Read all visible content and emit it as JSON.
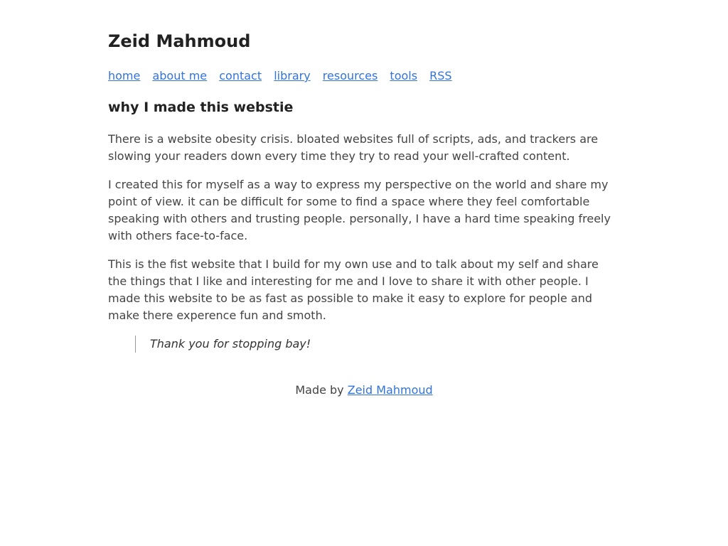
{
  "header": {
    "site_title": "Zeid Mahmoud"
  },
  "nav": {
    "items": [
      {
        "label": "home"
      },
      {
        "label": "about me"
      },
      {
        "label": "contact"
      },
      {
        "label": "library"
      },
      {
        "label": "resources"
      },
      {
        "label": "tools"
      },
      {
        "label": "RSS"
      }
    ]
  },
  "main": {
    "title": "why I made this webstie",
    "paragraphs": [
      "There is a website obesity crisis. bloated websites full of scripts, ads, and trackers are slowing your readers down every time they try to read your well-crafted content.",
      "I created this for myself as a way to express my perspective on the world and share my point of view. it can be difficult for some to find a space where they feel comfortable speaking with others and trusting people. personally, I have a hard time speaking freely with others face-to-face.",
      "This is the fist website that I build for my own use and to talk about my self and share the things that I like and interesting for me and I love to share it with other people. I made this website to be as fast as possible to make it easy to explore for people and make there experence fun and smoth."
    ],
    "quote": "Thank you for stopping bay!"
  },
  "footer": {
    "prefix": "Made by ",
    "author_link": "Zeid Mahmoud"
  },
  "colors": {
    "link": "#3273dc",
    "text": "#444444",
    "heading": "#222222"
  }
}
